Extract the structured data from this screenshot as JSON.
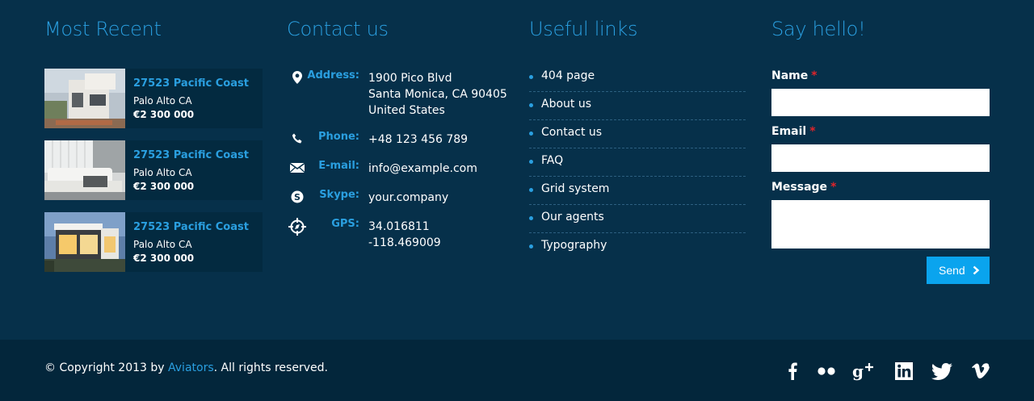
{
  "most_recent": {
    "title": "Most Recent",
    "items": [
      {
        "title": "27523 Pacific Coast",
        "location": "Palo Alto CA",
        "price": "€2 300 000"
      },
      {
        "title": "27523 Pacific Coast",
        "location": "Palo Alto CA",
        "price": "€2 300 000"
      },
      {
        "title": "27523 Pacific Coast",
        "location": "Palo Alto CA",
        "price": "€2 300 000"
      }
    ]
  },
  "contact": {
    "title": "Contact us",
    "address_label": "Address:",
    "address_lines": [
      "1900 Pico Blvd",
      "Santa Monica, CA 90405",
      "United States"
    ],
    "phone_label": "Phone:",
    "phone": "+48 123 456 789",
    "email_label": "E-mail:",
    "email": "info@example.com",
    "skype_label": "Skype:",
    "skype": "your.company",
    "gps_label": "GPS:",
    "gps_lines": [
      "34.016811",
      "-118.469009"
    ]
  },
  "links": {
    "title": "Useful links",
    "items": [
      "404 page",
      "About us",
      "Contact us",
      "FAQ",
      "Grid system",
      "Our agents",
      "Typography"
    ]
  },
  "hello": {
    "title": "Say hello!",
    "name_label": "Name",
    "email_label": "Email",
    "message_label": "Message",
    "required_mark": "*",
    "name_value": "",
    "email_value": "",
    "message_value": "",
    "send_label": "Send"
  },
  "bottom": {
    "copyright_prefix": "© Copyright 2013 by ",
    "copyright_link": "Aviators",
    "copyright_suffix": ". All rights reserved.",
    "socials": [
      "facebook-icon",
      "flickr-icon",
      "google-plus-icon",
      "linkedin-icon",
      "twitter-icon",
      "vimeo-icon"
    ]
  },
  "colors": {
    "background": "#06304a",
    "bottom_bar": "#03263b",
    "accent": "#2a9fe0",
    "button": "#0aa4ee",
    "required": "#e0242a"
  }
}
